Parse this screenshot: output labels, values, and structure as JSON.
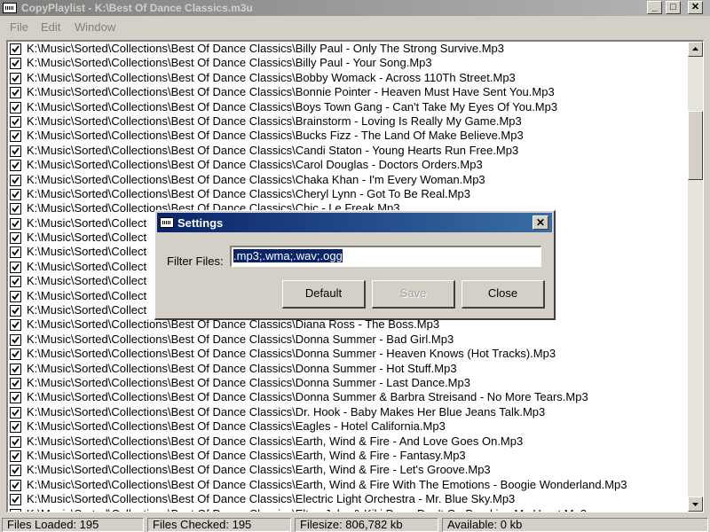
{
  "window": {
    "title": "CopyPlaylist - K:\\Best Of Dance Classics.m3u",
    "minimize_glyph": "_",
    "maximize_glyph": "□",
    "close_glyph": "✕"
  },
  "menu": {
    "file": "File",
    "edit": "Edit",
    "window": "Window"
  },
  "list": {
    "rows": [
      {
        "text": "K:\\Music\\Sorted\\Collections\\Best Of Dance Classics\\Billy Paul - Only The Strong Survive.Mp3",
        "checked": true
      },
      {
        "text": "K:\\Music\\Sorted\\Collections\\Best Of Dance Classics\\Billy Paul - Your Song.Mp3",
        "checked": true
      },
      {
        "text": "K:\\Music\\Sorted\\Collections\\Best Of Dance Classics\\Bobby Womack - Across 110Th Street.Mp3",
        "checked": true
      },
      {
        "text": "K:\\Music\\Sorted\\Collections\\Best Of Dance Classics\\Bonnie Pointer - Heaven Must Have Sent You.Mp3",
        "checked": true
      },
      {
        "text": "K:\\Music\\Sorted\\Collections\\Best Of Dance Classics\\Boys Town Gang - Can't Take My Eyes Of You.Mp3",
        "checked": true
      },
      {
        "text": "K:\\Music\\Sorted\\Collections\\Best Of Dance Classics\\Brainstorm - Loving Is Really My Game.Mp3",
        "checked": true
      },
      {
        "text": "K:\\Music\\Sorted\\Collections\\Best Of Dance Classics\\Bucks Fizz - The Land Of Make Believe.Mp3",
        "checked": true
      },
      {
        "text": "K:\\Music\\Sorted\\Collections\\Best Of Dance Classics\\Candi Staton - Young Hearts Run Free.Mp3",
        "checked": true
      },
      {
        "text": "K:\\Music\\Sorted\\Collections\\Best Of Dance Classics\\Carol Douglas - Doctors Orders.Mp3",
        "checked": true
      },
      {
        "text": "K:\\Music\\Sorted\\Collections\\Best Of Dance Classics\\Chaka Khan - I'm Every Woman.Mp3",
        "checked": true
      },
      {
        "text": "K:\\Music\\Sorted\\Collections\\Best Of Dance Classics\\Cheryl Lynn - Got To Be Real.Mp3",
        "checked": true
      },
      {
        "text": "K:\\Music\\Sorted\\Collections\\Best Of Dance Classics\\Chic - Le Freak.Mp3",
        "checked": true
      },
      {
        "text": "K:\\Music\\Sorted\\Collect",
        "checked": true
      },
      {
        "text": "K:\\Music\\Sorted\\Collect",
        "checked": true
      },
      {
        "text": "K:\\Music\\Sorted\\Collect",
        "checked": true
      },
      {
        "text": "K:\\Music\\Sorted\\Collect",
        "checked": true
      },
      {
        "text": "K:\\Music\\Sorted\\Collect",
        "checked": true
      },
      {
        "text": "K:\\Music\\Sorted\\Collect",
        "checked": true
      },
      {
        "text": "K:\\Music\\Sorted\\Collect",
        "checked": true
      },
      {
        "text": "K:\\Music\\Sorted\\Collections\\Best Of Dance Classics\\Diana Ross - The Boss.Mp3",
        "checked": true
      },
      {
        "text": "K:\\Music\\Sorted\\Collections\\Best Of Dance Classics\\Donna Summer - Bad Girl.Mp3",
        "checked": true
      },
      {
        "text": "K:\\Music\\Sorted\\Collections\\Best Of Dance Classics\\Donna Summer - Heaven Knows (Hot Tracks).Mp3",
        "checked": true
      },
      {
        "text": "K:\\Music\\Sorted\\Collections\\Best Of Dance Classics\\Donna Summer - Hot Stuff.Mp3",
        "checked": true
      },
      {
        "text": "K:\\Music\\Sorted\\Collections\\Best Of Dance Classics\\Donna Summer - Last Dance.Mp3",
        "checked": true
      },
      {
        "text": "K:\\Music\\Sorted\\Collections\\Best Of Dance Classics\\Donna Summer & Barbra Streisand - No More Tears.Mp3",
        "checked": true
      },
      {
        "text": "K:\\Music\\Sorted\\Collections\\Best Of Dance Classics\\Dr. Hook - Baby Makes Her Blue Jeans Talk.Mp3",
        "checked": true
      },
      {
        "text": "K:\\Music\\Sorted\\Collections\\Best Of Dance Classics\\Eagles - Hotel California.Mp3",
        "checked": true
      },
      {
        "text": "K:\\Music\\Sorted\\Collections\\Best Of Dance Classics\\Earth, Wind & Fire - And Love Goes On.Mp3",
        "checked": true
      },
      {
        "text": "K:\\Music\\Sorted\\Collections\\Best Of Dance Classics\\Earth, Wind & Fire - Fantasy.Mp3",
        "checked": true
      },
      {
        "text": "K:\\Music\\Sorted\\Collections\\Best Of Dance Classics\\Earth, Wind & Fire - Let's Groove.Mp3",
        "checked": true
      },
      {
        "text": "K:\\Music\\Sorted\\Collections\\Best Of Dance Classics\\Earth, Wind & Fire With The Emotions - Boogie Wonderland.Mp3",
        "checked": true
      },
      {
        "text": "K:\\Music\\Sorted\\Collections\\Best Of Dance Classics\\Electric Light Orchestra - Mr. Blue Sky.Mp3",
        "checked": true
      },
      {
        "text": "K:\\Music\\Sorted\\Collections\\Best Of Dance Classics\\Elton John & Kiki Dee - Don't Go Breaking My Heart.Mp3",
        "checked": true
      }
    ]
  },
  "status": {
    "files_loaded": "Files Loaded: 195",
    "files_checked": "Files Checked: 195",
    "filesize": "Filesize: 806,782 kb",
    "available": "Available: 0 kb"
  },
  "dialog": {
    "title": "Settings",
    "close_glyph": "✕",
    "filter_label": "Filter Files:",
    "filter_value": ".mp3;.wma;.wav;.ogg",
    "default_label": "Default",
    "save_label": "Save",
    "close_label": "Close"
  }
}
